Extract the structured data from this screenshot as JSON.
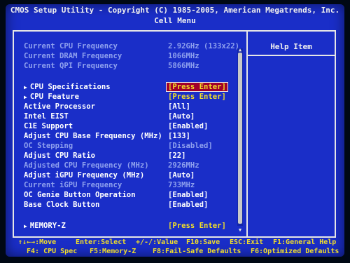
{
  "header": {
    "title": "CMOS Setup Utility - Copyright (C) 1985-2005, American Megatrends, Inc.",
    "menu": "Cell Menu"
  },
  "info": [
    {
      "label": "Current CPU Frequency",
      "value": "2.92GHz (133x22)"
    },
    {
      "label": "Current DRAM Frequency",
      "value": "1066MHz"
    },
    {
      "label": "Current QPI Frequency",
      "value": "5866MHz"
    }
  ],
  "items": [
    {
      "label": "CPU Specifications",
      "value": "[Press Enter]",
      "arrow": "▶"
    },
    {
      "label": "CPU Feature",
      "value": "[Press Enter]",
      "arrow": "▶"
    },
    {
      "label": "Active Processor",
      "value": "[All]"
    },
    {
      "label": "Intel EIST",
      "value": "[Auto]"
    },
    {
      "label": "C1E Support",
      "value": "[Enabled]"
    },
    {
      "label": "Adjust CPU Base Frequency (MHz)",
      "value": "[133]"
    },
    {
      "label": "OC Stepping",
      "value": "[Disabled]"
    },
    {
      "label": "Adjust CPU Ratio",
      "value": "[22]"
    },
    {
      "label": "Adjusted CPU Frequency (MHz)",
      "value": "2926MHz"
    },
    {
      "label": "Adjust iGPU Frequency (MHz)",
      "value": "[Auto]"
    },
    {
      "label": "Current iGPU Frequency",
      "value": "733MHz"
    },
    {
      "label": "OC Genie Button Operation",
      "value": "[Enabled]"
    },
    {
      "label": "Base Clock Button",
      "value": "[Enabled]"
    }
  ],
  "memory": {
    "label": "MEMORY-Z",
    "value": "[Press Enter]",
    "arrow": "▶"
  },
  "help": {
    "title": "Help Item"
  },
  "footer": {
    "keys": "↑↓←→:Move",
    "enter": "Enter:Select",
    "value": "+/-/:Value",
    "f10": "F10:Save",
    "esc": "ESC:Exit",
    "f1": "F1:General Help",
    "f4": "F4: CPU Spec",
    "f5": "F5:Memory-Z",
    "f8": "F8:Fail-Safe Defaults",
    "f6": "F6:Optimized Defaults"
  },
  "colors": {
    "background": "#1a2ec8",
    "highlight": "#f2de28",
    "selected_bg": "#a1002b",
    "dim": "#8ea0ee"
  }
}
